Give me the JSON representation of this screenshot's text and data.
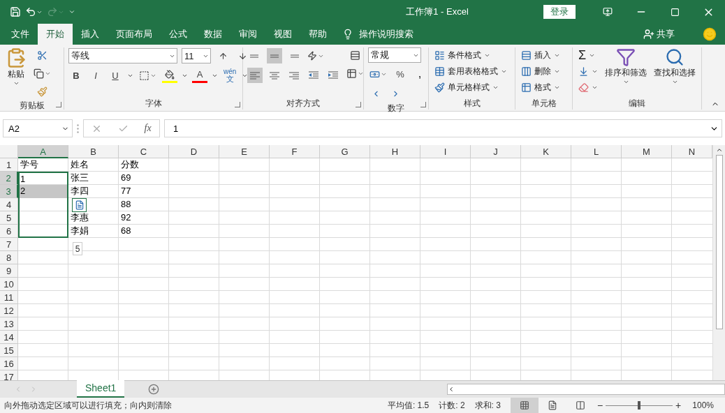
{
  "title_bar": {
    "title": "工作簿1 - Excel",
    "sign_in": "登录"
  },
  "quick_access": [
    {
      "kind": "save",
      "disabled": false
    },
    {
      "kind": "undo",
      "disabled": false
    },
    {
      "kind": "redo",
      "disabled": true
    },
    {
      "kind": "customize",
      "disabled": false
    }
  ],
  "menu_tabs": [
    {
      "label": "文件",
      "selected": false
    },
    {
      "label": "开始",
      "selected": true
    },
    {
      "label": "插入",
      "selected": false
    },
    {
      "label": "页面布局",
      "selected": false
    },
    {
      "label": "公式",
      "selected": false
    },
    {
      "label": "数据",
      "selected": false
    },
    {
      "label": "审阅",
      "selected": false
    },
    {
      "label": "视图",
      "selected": false
    },
    {
      "label": "帮助",
      "selected": false
    }
  ],
  "tell_me": "操作说明搜索",
  "share": "共享",
  "ribbon": {
    "clipboard": {
      "label": "剪贴板",
      "paste": "粘贴"
    },
    "font": {
      "label": "字体",
      "font_name": "等线",
      "font_size": "11",
      "bold": "B",
      "italic": "I",
      "underline": "U",
      "font_color_letter": "A",
      "phonetic_top": "wén",
      "phonetic_bottom": "文"
    },
    "alignment": {
      "label": "对齐方式",
      "vertical": [
        {
          "kind": "top",
          "selected": false
        },
        {
          "kind": "middle",
          "selected": true
        },
        {
          "kind": "bottom",
          "selected": false
        }
      ],
      "horizontal": [
        {
          "kind": "left",
          "selected": true
        },
        {
          "kind": "center",
          "selected": false
        },
        {
          "kind": "right",
          "selected": false
        }
      ]
    },
    "number": {
      "label": "数字",
      "format": "常规",
      "percent": "%",
      "comma": ","
    },
    "styles": {
      "label": "样式",
      "items": [
        "条件格式",
        "套用表格格式",
        "单元格样式"
      ]
    },
    "cells": {
      "label": "单元格",
      "items": [
        "插入",
        "删除",
        "格式"
      ]
    },
    "editing": {
      "label": "编辑",
      "sum": "Σ",
      "sort": "排序和筛选",
      "find": "查找和选择"
    }
  },
  "formula_bar": {
    "name_box": "A2",
    "fx": "fx",
    "value": "1"
  },
  "grid": {
    "columns": [
      {
        "label": "A",
        "selected": true
      },
      {
        "label": "B",
        "selected": false
      },
      {
        "label": "C",
        "selected": false
      },
      {
        "label": "D",
        "selected": false
      },
      {
        "label": "E",
        "selected": false
      },
      {
        "label": "F",
        "selected": false
      },
      {
        "label": "G",
        "selected": false
      },
      {
        "label": "H",
        "selected": false
      },
      {
        "label": "I",
        "selected": false
      },
      {
        "label": "J",
        "selected": false
      },
      {
        "label": "K",
        "selected": false
      },
      {
        "label": "L",
        "selected": false
      },
      {
        "label": "M",
        "selected": false
      },
      {
        "label": "N",
        "selected": false
      }
    ],
    "rows": [
      {
        "header": "1",
        "selected": false,
        "cells": [
          {
            "text": "学号",
            "selected": false,
            "fill_range": false
          },
          {
            "text": "姓名",
            "selected": false,
            "fill_range": false
          },
          {
            "text": "分数",
            "selected": false,
            "fill_range": false
          }
        ]
      },
      {
        "header": "2",
        "selected": true,
        "cells": [
          {
            "text": "1",
            "selected": false,
            "fill_range": true
          },
          {
            "text": "张三",
            "selected": false,
            "fill_range": false
          },
          {
            "text": "69",
            "selected": false,
            "fill_range": false
          }
        ]
      },
      {
        "header": "3",
        "selected": true,
        "cells": [
          {
            "text": "2",
            "selected": true,
            "fill_range": true
          },
          {
            "text": "李四",
            "selected": false,
            "fill_range": false
          },
          {
            "text": "77",
            "selected": false,
            "fill_range": false
          }
        ]
      },
      {
        "header": "4",
        "selected": false,
        "cells": [
          {
            "selected": false,
            "fill_range": true
          },
          {
            "selected": false,
            "fill_range": false
          },
          {
            "text": "88",
            "selected": false,
            "fill_range": false
          }
        ]
      },
      {
        "header": "5",
        "selected": false,
        "cells": [
          {
            "selected": false,
            "fill_range": true
          },
          {
            "text": "李惠",
            "selected": false,
            "fill_range": false
          },
          {
            "text": "92",
            "selected": false,
            "fill_range": false
          }
        ]
      },
      {
        "header": "6",
        "selected": false,
        "cells": [
          {
            "selected": false,
            "fill_range": true
          },
          {
            "text": "李娟",
            "selected": false,
            "fill_range": false
          },
          {
            "text": "68",
            "selected": false,
            "fill_range": false
          }
        ]
      },
      {
        "header": "7",
        "selected": false,
        "cells": []
      },
      {
        "header": "8",
        "selected": false,
        "cells": []
      },
      {
        "header": "9",
        "selected": false,
        "cells": []
      },
      {
        "header": "10",
        "selected": false,
        "cells": []
      },
      {
        "header": "11",
        "selected": false,
        "cells": []
      },
      {
        "header": "12",
        "selected": false,
        "cells": []
      },
      {
        "header": "13",
        "selected": false,
        "cells": []
      },
      {
        "header": "14",
        "selected": false,
        "cells": []
      },
      {
        "header": "15",
        "selected": false,
        "cells": []
      },
      {
        "header": "16",
        "selected": false,
        "cells": []
      },
      {
        "header": "17",
        "selected": false,
        "cells": []
      }
    ],
    "fill_tooltip": "5"
  },
  "sheet_tabs": [
    {
      "label": "Sheet1",
      "selected": true
    }
  ],
  "status_bar": {
    "message": "向外拖动选定区域可以进行填充；向内则清除",
    "stats": [
      "平均值: 1.5",
      "计数: 2",
      "求和: 3"
    ],
    "views": [
      {
        "kind": "normal",
        "selected": true
      },
      {
        "kind": "page_layout",
        "selected": false
      },
      {
        "kind": "page_break",
        "selected": false
      }
    ],
    "zoom_minus": "−",
    "zoom_plus": "+",
    "zoom": {
      "level": 0.5,
      "reading": "100%"
    }
  }
}
